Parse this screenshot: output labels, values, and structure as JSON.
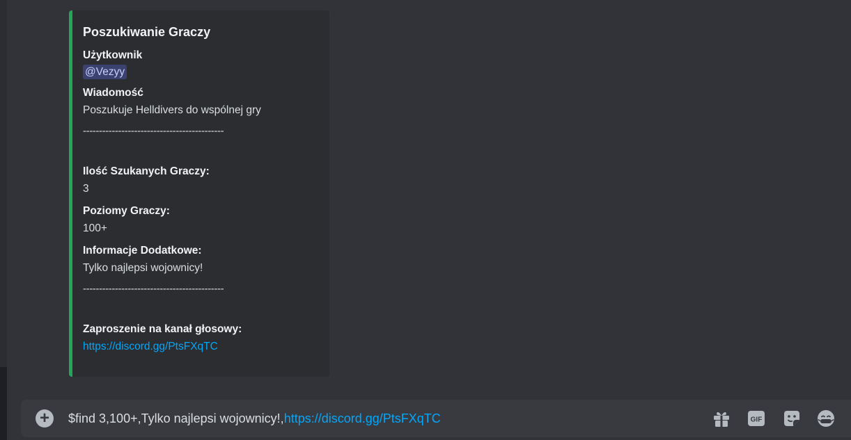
{
  "embed": {
    "title": "Poszukiwanie Graczy",
    "accent_color": "#23a55a",
    "fields": {
      "user_label": "Użytkownik",
      "user_mention": "@Vezyy",
      "message_label": "Wiadomość",
      "message_value": "Poszukuje Helldivers do wspólnej gry",
      "divider": "--------------------------------------------",
      "players_label": "Ilość Szukanych Graczy:",
      "players_value": "3",
      "levels_label": "Poziomy Graczy:",
      "levels_value": "100+",
      "info_label": "Informacje Dodatkowe:",
      "info_value": "Tylko najlepsi wojownicy!",
      "invite_label": "Zaproszenie na kanał głosowy:",
      "invite_link": "https://discord.gg/PtsFXqTC"
    }
  },
  "composer": {
    "text_prefix": "$find 3,100+,Tylko najlepsi wojownicy!,",
    "text_link": "https://discord.gg/PtsFXqTC",
    "icons": [
      "gift-icon",
      "gif-icon",
      "sticker-icon",
      "emoji-icon"
    ],
    "gif_label": "GIF"
  },
  "colors": {
    "background": "#313338",
    "embed_bg": "#2b2d31",
    "link": "#00a8fc",
    "mention_bg": "#3c4270"
  }
}
